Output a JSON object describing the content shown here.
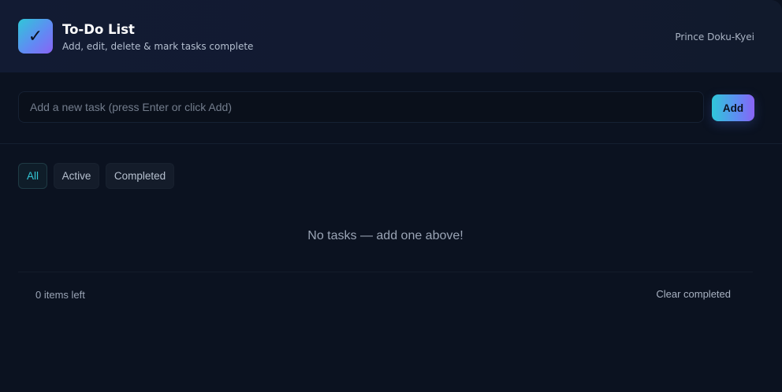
{
  "header": {
    "logo_icon": "check-icon",
    "logo_glyph": "✓",
    "title": "To-Do List",
    "subtitle": "Add, edit, delete & mark tasks complete",
    "author": "Prince Doku-Kyei"
  },
  "task_input": {
    "value": "",
    "placeholder": "Add a new task (press Enter or click Add)",
    "add_label": "Add"
  },
  "filters": {
    "selected": "All",
    "items": [
      {
        "label": "All"
      },
      {
        "label": "Active"
      },
      {
        "label": "Completed"
      }
    ]
  },
  "tasks": {
    "empty_message": "No tasks — add one above!"
  },
  "footer": {
    "items_left": "0 items left",
    "clear_label": "Clear completed"
  },
  "colors": {
    "background": "#0b1220",
    "accent_start": "#2fc7d8",
    "accent_end": "#8a63f5",
    "selected_filter": "#33c6d6"
  }
}
